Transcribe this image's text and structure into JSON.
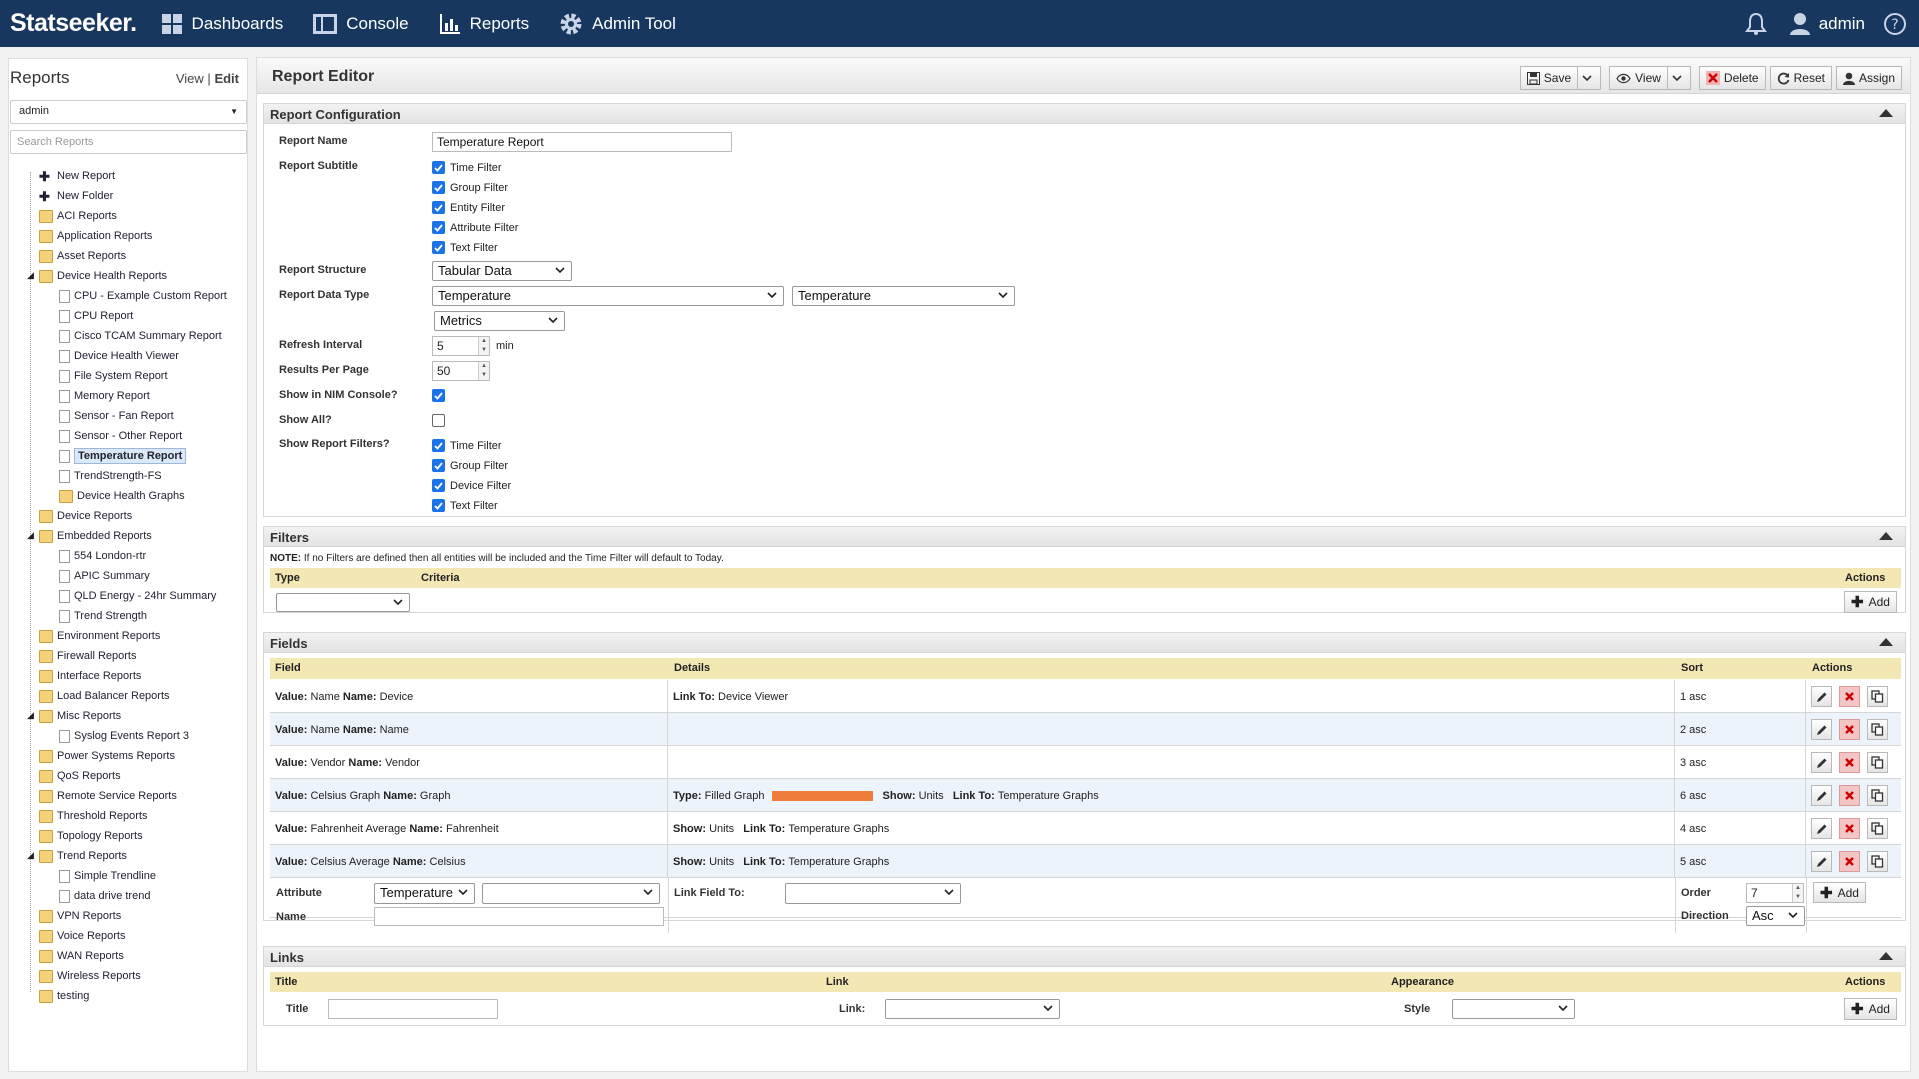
{
  "topbar": {
    "brand": "Statseeker.",
    "nav": [
      {
        "label": "Dashboards",
        "icon": "dashboard-grid-icon"
      },
      {
        "label": "Console",
        "icon": "console-icon"
      },
      {
        "label": "Reports",
        "icon": "bar-chart-icon"
      },
      {
        "label": "Admin Tool",
        "icon": "gear-icon"
      }
    ],
    "user": "admin"
  },
  "sidebar": {
    "title": "Reports",
    "view_label": "View",
    "separator": "|",
    "edit_label": "Edit",
    "user_select": "admin",
    "search_placeholder": "Search Reports",
    "tree": [
      {
        "label": "New Report",
        "kind": "action",
        "level": 1
      },
      {
        "label": "New Folder",
        "kind": "action",
        "level": 1
      },
      {
        "label": "ACI Reports",
        "kind": "folder",
        "level": 1
      },
      {
        "label": "Application Reports",
        "kind": "folder",
        "level": 1
      },
      {
        "label": "Asset Reports",
        "kind": "folder",
        "level": 1
      },
      {
        "label": "Device Health Reports",
        "kind": "folder",
        "level": 1,
        "expanded": true
      },
      {
        "label": "CPU - Example Custom Report",
        "kind": "doc",
        "level": 2
      },
      {
        "label": "CPU Report",
        "kind": "doc",
        "level": 2
      },
      {
        "label": "Cisco TCAM Summary Report",
        "kind": "doc",
        "level": 2
      },
      {
        "label": "Device Health Viewer",
        "kind": "doc",
        "level": 2
      },
      {
        "label": "File System Report",
        "kind": "doc",
        "level": 2
      },
      {
        "label": "Memory Report",
        "kind": "doc",
        "level": 2
      },
      {
        "label": "Sensor - Fan Report",
        "kind": "doc",
        "level": 2
      },
      {
        "label": "Sensor - Other Report",
        "kind": "doc",
        "level": 2
      },
      {
        "label": "Temperature Report",
        "kind": "doc",
        "level": 2,
        "selected": true
      },
      {
        "label": "TrendStrength-FS",
        "kind": "doc",
        "level": 2
      },
      {
        "label": "Device Health Graphs",
        "kind": "folder",
        "level": 2
      },
      {
        "label": "Device Reports",
        "kind": "folder",
        "level": 1
      },
      {
        "label": "Embedded Reports",
        "kind": "folder",
        "level": 1,
        "expanded": true
      },
      {
        "label": "554 London-rtr",
        "kind": "doc",
        "level": 2
      },
      {
        "label": "APIC Summary",
        "kind": "doc",
        "level": 2
      },
      {
        "label": "QLD Energy - 24hr Summary",
        "kind": "doc",
        "level": 2
      },
      {
        "label": "Trend Strength",
        "kind": "doc",
        "level": 2
      },
      {
        "label": "Environment Reports",
        "kind": "folder",
        "level": 1
      },
      {
        "label": "Firewall Reports",
        "kind": "folder",
        "level": 1
      },
      {
        "label": "Interface Reports",
        "kind": "folder",
        "level": 1
      },
      {
        "label": "Load Balancer Reports",
        "kind": "folder",
        "level": 1
      },
      {
        "label": "Misc Reports",
        "kind": "folder",
        "level": 1,
        "expanded": true
      },
      {
        "label": "Syslog Events Report 3",
        "kind": "doc",
        "level": 2
      },
      {
        "label": "Power Systems Reports",
        "kind": "folder",
        "level": 1
      },
      {
        "label": "QoS Reports",
        "kind": "folder",
        "level": 1
      },
      {
        "label": "Remote Service Reports",
        "kind": "folder",
        "level": 1
      },
      {
        "label": "Threshold Reports",
        "kind": "folder",
        "level": 1
      },
      {
        "label": "Topology Reports",
        "kind": "folder",
        "level": 1
      },
      {
        "label": "Trend Reports",
        "kind": "folder",
        "level": 1,
        "expanded": true
      },
      {
        "label": "Simple Trendline",
        "kind": "doc",
        "level": 2
      },
      {
        "label": "data drive trend",
        "kind": "doc",
        "level": 2
      },
      {
        "label": "VPN Reports",
        "kind": "folder",
        "level": 1
      },
      {
        "label": "Voice Reports",
        "kind": "folder",
        "level": 1
      },
      {
        "label": "WAN Reports",
        "kind": "folder",
        "level": 1
      },
      {
        "label": "Wireless Reports",
        "kind": "folder",
        "level": 1
      },
      {
        "label": "testing",
        "kind": "folder",
        "level": 1
      }
    ]
  },
  "editor": {
    "title": "Report Editor",
    "toolbar": {
      "save": "Save",
      "view": "View",
      "delete": "Delete",
      "reset": "Reset",
      "assign": "Assign"
    },
    "config": {
      "heading": "Report Configuration",
      "report_name_label": "Report Name",
      "report_name": "Temperature Report",
      "subtitle_label": "Report Subtitle",
      "subtitle_filters": [
        "Time Filter",
        "Group Filter",
        "Entity Filter",
        "Attribute Filter",
        "Text Filter"
      ],
      "structure_label": "Report Structure",
      "structure": "Tabular Data",
      "data_type_label": "Report Data Type",
      "data_type_1": "Temperature",
      "data_type_2": "Temperature",
      "data_type_3": "Metrics",
      "refresh_label": "Refresh Interval",
      "refresh": "5",
      "refresh_unit": "min",
      "results_label": "Results Per Page",
      "results": "50",
      "nim_label": "Show in NIM Console?",
      "nim_checked": true,
      "showall_label": "Show All?",
      "showall_checked": false,
      "report_filters_label": "Show Report Filters?",
      "report_filters": [
        "Time Filter",
        "Group Filter",
        "Device Filter",
        "Text Filter"
      ]
    },
    "filters": {
      "heading": "Filters",
      "note_bold": "NOTE:",
      "note": "If no Filters are defined then all entities will be included and the Time Filter will default to Today.",
      "col_type": "Type",
      "col_criteria": "Criteria",
      "col_actions": "Actions",
      "add": "Add"
    },
    "fields": {
      "heading": "Fields",
      "col_field": "Field",
      "col_details": "Details",
      "col_sort": "Sort",
      "col_actions": "Actions",
      "value_key": "Value:",
      "name_key": "Name:",
      "rows": [
        {
          "value": "Name",
          "name": "Device",
          "details": [
            {
              "k": "Link To:",
              "v": "Device Viewer"
            }
          ],
          "sort": "1 asc"
        },
        {
          "value": "Name",
          "name": "Name",
          "details": [],
          "sort": "2 asc"
        },
        {
          "value": "Vendor",
          "name": "Vendor",
          "details": [],
          "sort": "3 asc"
        },
        {
          "value": "Celsius Graph",
          "name": "Graph",
          "details": [
            {
              "k": "Type:",
              "v": "Filled Graph"
            },
            {
              "k": "Show:",
              "v": "Units"
            },
            {
              "k": "Link To:",
              "v": "Temperature Graphs"
            }
          ],
          "sort": "6 asc",
          "graph_color": "#ef7d3c"
        },
        {
          "value": "Fahrenheit Average",
          "name": "Fahrenheit",
          "details": [
            {
              "k": "Show:",
              "v": "Units"
            },
            {
              "k": "Link To:",
              "v": "Temperature Graphs"
            }
          ],
          "sort": "4 asc"
        },
        {
          "value": "Celsius Average",
          "name": "Celsius",
          "details": [
            {
              "k": "Show:",
              "v": "Units"
            },
            {
              "k": "Link To:",
              "v": "Temperature Graphs"
            }
          ],
          "sort": "5 asc"
        }
      ],
      "new_attribute_label": "Attribute",
      "new_attribute": "Temperature",
      "new_name_label": "Name",
      "link_field_label": "Link Field To:",
      "order_label": "Order",
      "order": "7",
      "direction_label": "Direction",
      "direction": "Asc",
      "add": "Add"
    },
    "links": {
      "heading": "Links",
      "col_title": "Title",
      "col_link": "Link",
      "col_appearance": "Appearance",
      "col_actions": "Actions",
      "title_label": "Title",
      "link_label": "Link:",
      "style_label": "Style",
      "add": "Add"
    }
  }
}
